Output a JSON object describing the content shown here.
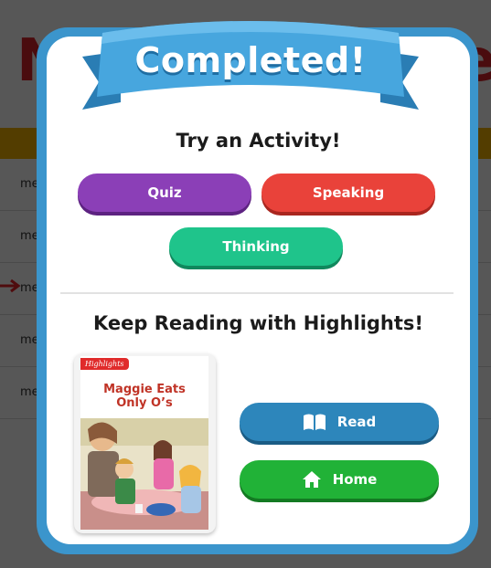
{
  "background": {
    "title_left": "Ne",
    "title_right": "ice",
    "row_label": "me"
  },
  "modal": {
    "ribbon_title": "Completed!",
    "activity_heading": "Try an Activity!",
    "activities": {
      "quiz": "Quiz",
      "speaking": "Speaking",
      "thinking": "Thinking"
    },
    "reading_heading": "Keep Reading with Highlights!",
    "book": {
      "badge": "Highlights",
      "title_line1": "Maggie Eats",
      "title_line2": "Only O’s"
    },
    "read_label": "Read",
    "home_label": "Home"
  },
  "colors": {
    "frame": "#3b95cc",
    "quiz": "#8b3fb7",
    "speaking": "#e9423a",
    "thinking": "#1fc48b",
    "read": "#2d86bb",
    "home": "#21b237",
    "background_title": "#d8232a",
    "background_band": "#f4b400",
    "arrow": "#e8232a"
  },
  "icons": {
    "read": "open-book-icon",
    "home": "house-icon",
    "arrow": "arrow-right-icon"
  }
}
